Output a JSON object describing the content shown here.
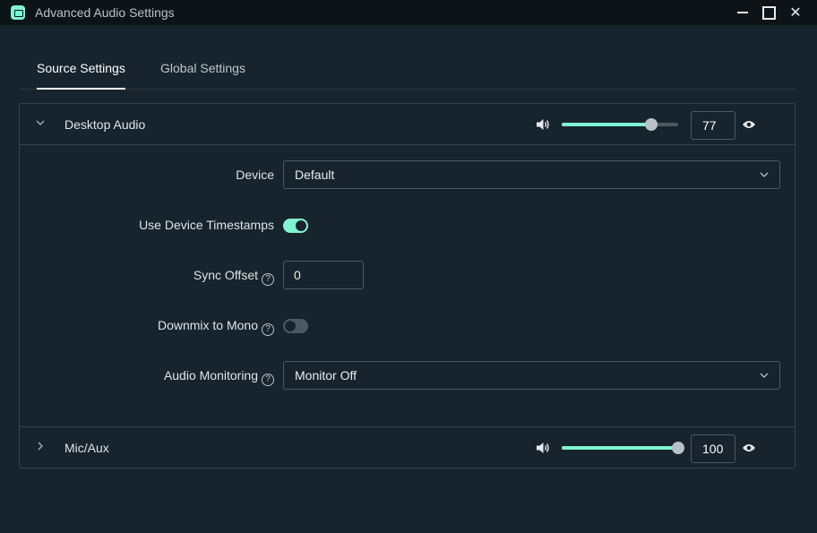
{
  "window": {
    "title": "Advanced Audio Settings",
    "close_glyph": "✕"
  },
  "tabs": [
    {
      "label": "Source Settings",
      "active": true
    },
    {
      "label": "Global Settings",
      "active": false
    }
  ],
  "sources": [
    {
      "name": "Desktop Audio",
      "expanded": true,
      "volume": 77,
      "volume_label": "77",
      "icon_chevron": "chevron-down-icon"
    },
    {
      "name": "Mic/Aux",
      "expanded": false,
      "volume": 100,
      "volume_label": "100",
      "icon_chevron": "chevron-right-icon"
    }
  ],
  "settings": {
    "device": {
      "label": "Device",
      "value": "Default"
    },
    "timestamps": {
      "label": "Use Device Timestamps",
      "on": true
    },
    "sync_offset": {
      "label": "Sync Offset",
      "value": "0"
    },
    "downmix": {
      "label": "Downmix to Mono",
      "on": false
    },
    "monitoring": {
      "label": "Audio Monitoring",
      "value": "Monitor Off"
    }
  },
  "help_glyph": "?",
  "colors": {
    "accent": "#80f5d2",
    "background": "#17242d",
    "titlebar": "#0d1418",
    "border": "#34434c"
  }
}
